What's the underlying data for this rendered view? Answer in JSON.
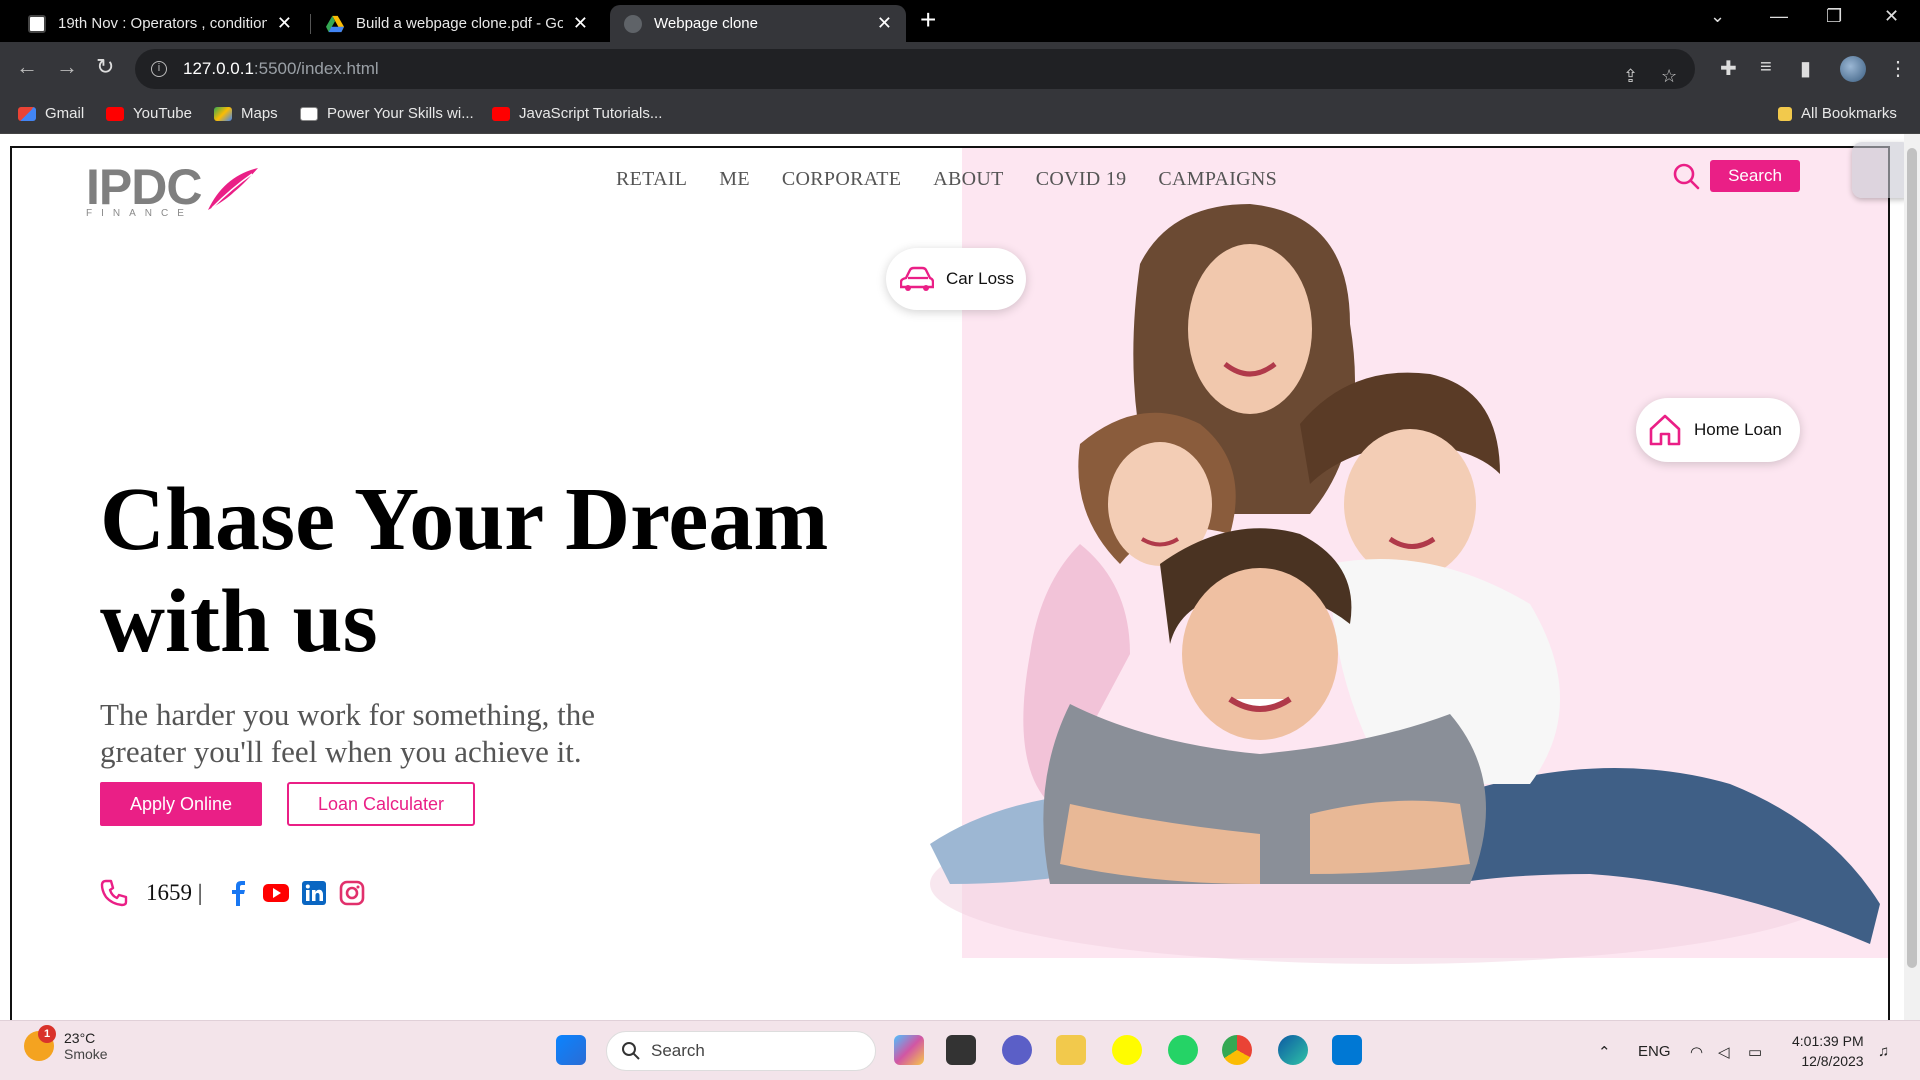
{
  "browser": {
    "tabs": [
      {
        "title": "19th Nov : Operators , condition",
        "active": false
      },
      {
        "title": "Build a webpage clone.pdf - Goo",
        "active": false
      },
      {
        "title": "Webpage clone",
        "active": true
      }
    ],
    "url_host": "127.0.0.1",
    "url_path": ":5500/index.html",
    "bookmarks": [
      "Gmail",
      "YouTube",
      "Maps",
      "Power Your Skills wi...",
      "JavaScript Tutorials..."
    ],
    "all_bookmarks": "All Bookmarks"
  },
  "page": {
    "logo_text": "IPDC",
    "logo_sub": "FINANCE",
    "nav": [
      "RETAIL",
      "ME",
      "CORPORATE",
      "ABOUT",
      "COVID 19",
      "CAMPAIGNS"
    ],
    "search_label": "Search",
    "hero_title_line1": "Chase Your Dream",
    "hero_title_line2": "with us",
    "hero_subtitle": "The harder you work for something, the greater you'll feel when you achieve it.",
    "apply_label": "Apply Online",
    "calc_label": "Loan Calculater",
    "phone": "1659 |",
    "chip_car": "Car Loss",
    "chip_home": "Home Loan",
    "accent": "#ea1f86"
  },
  "taskbar": {
    "temp": "23°C",
    "condition": "Smoke",
    "weather_badge": "1",
    "search_label": "Search",
    "lang": "ENG",
    "time": "4:01:39 PM",
    "date": "12/8/2023"
  }
}
